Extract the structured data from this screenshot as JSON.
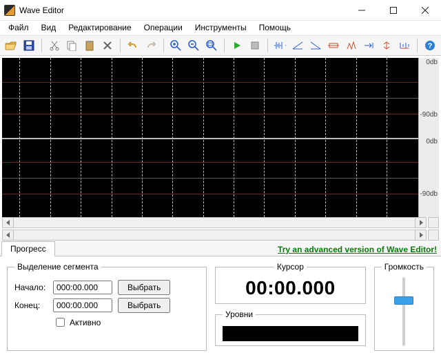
{
  "window": {
    "title": "Wave Editor"
  },
  "menu": {
    "items": [
      "Файл",
      "Вид",
      "Редактирование",
      "Операции",
      "Инструменты",
      "Помощь"
    ]
  },
  "toolbar": {
    "open": "Open",
    "save": "Save",
    "cut": "Cut",
    "copy": "Copy",
    "paste": "Paste",
    "delete": "Delete",
    "undo": "Undo",
    "redo": "Redo",
    "zoom_in": "Zoom In",
    "zoom_out": "Zoom Out",
    "zoom_sel": "Zoom Selection",
    "play": "Play",
    "stop": "Stop",
    "fx": [
      "Normalize",
      "Fade In",
      "Fade Out",
      "Insert Silence",
      "Amplify",
      "Reverse",
      "Invert",
      "Resample"
    ],
    "help": "Help"
  },
  "waveform": {
    "ruler": {
      "zero": "0db",
      "neg90": "-90db"
    }
  },
  "tabs": {
    "progress": "Прогресс",
    "promo": "Try an advanced version of Wave Editor!"
  },
  "segment": {
    "legend": "Выделение сегмента",
    "start_label": "Начало:",
    "end_label": "Конец:",
    "start_value": "000:00.000",
    "end_value": "000:00.000",
    "select_button": "Выбрать",
    "active_label": "Активно",
    "active_checked": false
  },
  "cursor": {
    "legend": "Курсор",
    "time": "00:00.000"
  },
  "levels": {
    "legend": "Уровни"
  },
  "volume": {
    "legend": "Громкость"
  }
}
